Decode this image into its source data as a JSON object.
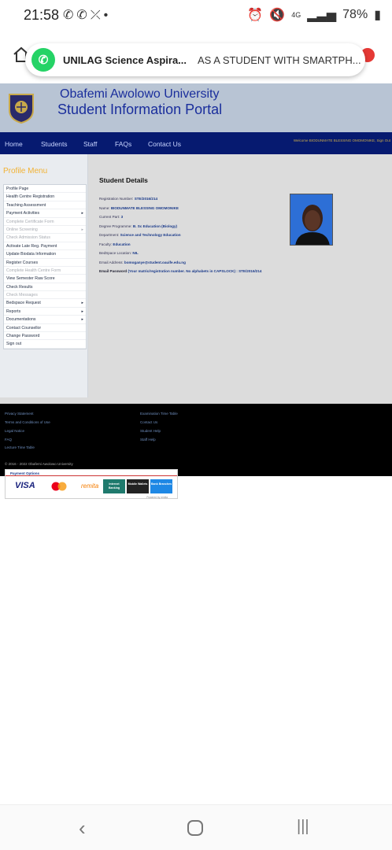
{
  "status_bar": {
    "time": "21:58",
    "battery": "78%",
    "network": "4G"
  },
  "notification": {
    "app": "WhatsApp",
    "title": "UNILAG Science Aspira...",
    "message": "AS A STUDENT WITH SMARTPH..."
  },
  "site": {
    "university_name": "Obafemi Awolowo University",
    "portal_name": "Student Information Portal"
  },
  "nav": {
    "items": [
      "Home",
      "Students",
      "Staff",
      "FAQs",
      "Contact Us"
    ],
    "welcome_label": "Welcome",
    "welcome_name": "BIODUNMATE BLESSING OMOMONIKE, Sign Out"
  },
  "sidebar": {
    "heading": "Profile Menu",
    "items": [
      {
        "label": "Profile Page",
        "dim": false,
        "arrow": false
      },
      {
        "label": "Health Centre Registration",
        "dim": false,
        "arrow": false
      },
      {
        "label": "Teaching Assessment",
        "dim": false,
        "arrow": false
      },
      {
        "label": "Payment Activities",
        "dim": false,
        "arrow": true
      },
      {
        "label": "Complete Certificate Form",
        "dim": true,
        "arrow": false
      },
      {
        "label": "Online Screening",
        "dim": true,
        "arrow": true
      },
      {
        "label": "Check Admission Status",
        "dim": true,
        "arrow": false
      },
      {
        "label": "Activate Late Reg. Payment",
        "dim": false,
        "arrow": false
      },
      {
        "label": "Update Biodata Information",
        "dim": false,
        "arrow": false
      },
      {
        "label": "Register Courses",
        "dim": false,
        "arrow": false
      },
      {
        "label": "Complete Health Centre Form",
        "dim": true,
        "arrow": false
      },
      {
        "label": "View Semester Raw Score",
        "dim": false,
        "arrow": false
      },
      {
        "label": "Check Results",
        "dim": false,
        "arrow": false
      },
      {
        "label": "Check Messages",
        "dim": true,
        "arrow": false
      },
      {
        "label": "Bedspace Request",
        "dim": false,
        "arrow": true
      },
      {
        "label": "Reports",
        "dim": false,
        "arrow": true
      },
      {
        "label": "Documentations",
        "dim": false,
        "arrow": true
      },
      {
        "label": "Contact Counsellor",
        "dim": false,
        "arrow": false
      },
      {
        "label": "Change Password",
        "dim": false,
        "arrow": false
      },
      {
        "label": "Sign out",
        "dim": false,
        "arrow": false
      }
    ]
  },
  "student": {
    "heading": "Student Details",
    "rows": [
      {
        "label": "Registration Number:",
        "value": "STE/2016/214"
      },
      {
        "label": "Name:",
        "value": "BIODUNMATE BLESSING OMOMONIKE"
      },
      {
        "label": "Current Part:",
        "value": "3"
      },
      {
        "label": "Degree Programme:",
        "value": "B. Sc Education (Biology)"
      },
      {
        "label": "Department:",
        "value": "Science and Technology Education"
      },
      {
        "label": "Faculty:",
        "value": "Education"
      },
      {
        "label": "BedSpace Location:",
        "value": "NIL"
      },
      {
        "label": "Email Address:",
        "value": "bomoganye@student.oauife.edu.ng"
      },
      {
        "label": "Email Password",
        "value": "(Your matric/registration number. No alphabets in CAPSLOCK) : STE/2016/214"
      }
    ]
  },
  "footer": {
    "left_links": [
      "Privacy Statement",
      "Terms and Conditions of Use",
      "Legal Notice",
      "FAQ",
      "Lecture Time Table"
    ],
    "right_links": [
      "Examination Time Table",
      "Contact Us",
      "Student Help",
      "Staff Help"
    ],
    "copyright": "© 2016 - 2022 Obafemi Awolowo University"
  },
  "payment": {
    "title": "Payment Options",
    "visa": "VISA",
    "remita": "remita",
    "buttons": [
      {
        "label": "Internet Banking",
        "color": "#1f7a6d"
      },
      {
        "label": "Mobile Wallets",
        "color": "#222222"
      },
      {
        "label": "Bank Branches",
        "color": "#1e88e5"
      }
    ],
    "powered": "Powered by remita"
  }
}
